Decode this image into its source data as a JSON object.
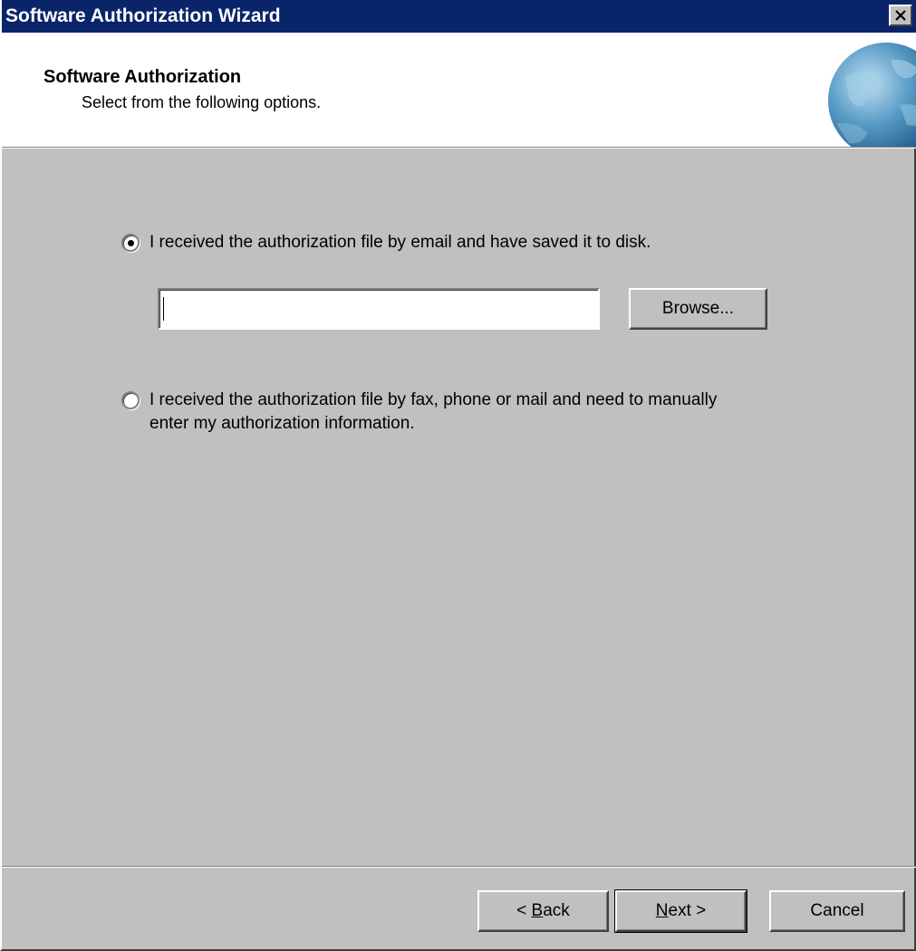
{
  "window": {
    "title": "Software Authorization Wizard"
  },
  "header": {
    "title": "Software Authorization",
    "subtitle": "Select from the following options."
  },
  "options": {
    "email": {
      "label": "I received the authorization file by email and have saved it to disk.",
      "selected": true
    },
    "manual": {
      "label_line1": "I received the authorization file by fax, phone or mail and need to manually",
      "label_line2": "enter my authorization information.",
      "selected": false
    }
  },
  "file_path": {
    "value": ""
  },
  "buttons": {
    "browse": "Browse...",
    "back_prefix": "< ",
    "back_mnemonic": "B",
    "back_rest": "ack",
    "next_mnemonic": "N",
    "next_rest": "ext >",
    "cancel": "Cancel"
  },
  "icons": {
    "close": "close-icon",
    "header_logo": "globe-icon"
  },
  "colors": {
    "titlebar": "#0a246a",
    "face": "#c0c0c0",
    "header_bg": "#ffffff"
  }
}
